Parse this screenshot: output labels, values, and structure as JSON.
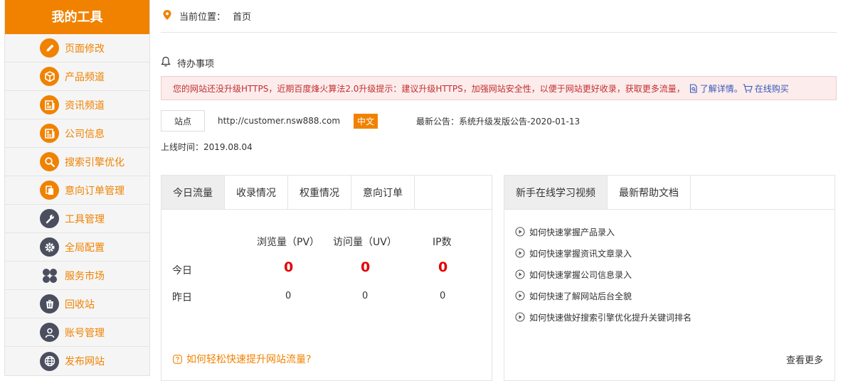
{
  "sidebar": {
    "title": "我的工具",
    "items": [
      {
        "label": "页面修改",
        "icon": "pencil-icon"
      },
      {
        "label": "产品频道",
        "icon": "box-icon"
      },
      {
        "label": "资讯频道",
        "icon": "news-icon"
      },
      {
        "label": "公司信息",
        "icon": "company-icon"
      },
      {
        "label": "搜索引擎优化",
        "icon": "search-icon"
      },
      {
        "label": "意向订单管理",
        "icon": "document-icon"
      },
      {
        "label": "工具管理",
        "icon": "wrench-icon"
      },
      {
        "label": "全局配置",
        "icon": "gear-icon"
      },
      {
        "label": "服务市场",
        "icon": "grid-icon"
      },
      {
        "label": "回收站",
        "icon": "trash-icon"
      },
      {
        "label": "账号管理",
        "icon": "user-icon"
      },
      {
        "label": "发布网站",
        "icon": "globe-icon"
      }
    ]
  },
  "breadcrumb": {
    "label": "当前位置：",
    "current": "首页"
  },
  "todo": {
    "title": "待办事项"
  },
  "alert": {
    "text": "您的网站还没升级HTTPS，近期百度烽火算法2.0升级提示：建议升级HTTPS，加强网站安全性，以便于网站更好收录，获取更多流量，",
    "detail_link": "了解详情",
    "dot": "。",
    "buy_link": "在线购买"
  },
  "site": {
    "button": "站点",
    "url": "http://customer.nsw888.com",
    "lang": "中文",
    "notice": "最新公告：系统升级发版公告-2020-01-13",
    "online": "上线时间：2019.08.04"
  },
  "stats_panel": {
    "tabs": [
      "今日流量",
      "收录情况",
      "权重情况",
      "意向订单"
    ],
    "headers": [
      "浏览量（PV）",
      "访问量（UV）",
      "IP数"
    ],
    "rows": [
      {
        "label": "今日",
        "values": [
          "0",
          "0",
          "0"
        ]
      },
      {
        "label": "昨日",
        "values": [
          "0",
          "0",
          "0"
        ]
      }
    ],
    "link": "如何轻松快速提升网站流量?"
  },
  "help_panel": {
    "tabs": [
      "新手在线学习视频",
      "最新帮助文档"
    ],
    "videos": [
      "如何快速掌握产品录入",
      "如何快速掌握资讯文章录入",
      "如何快速掌握公司信息录入",
      "如何快速了解网站后台全貌",
      "如何快速做好搜索引擎优化提升关键词排名"
    ],
    "more": "查看更多"
  },
  "colors": {
    "accent": "#f08200",
    "alert_text": "#c2302f",
    "alert_bg": "#fcecec",
    "link": "#3757b8",
    "big_value": "#e30000"
  }
}
